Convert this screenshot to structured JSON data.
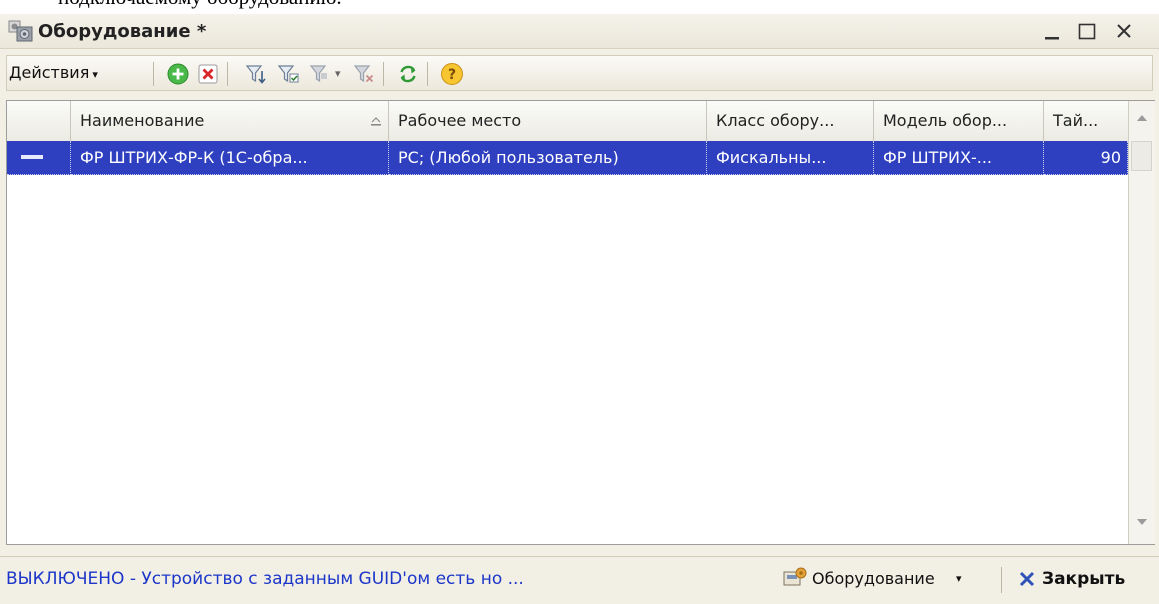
{
  "background_text": "подключаемому оборудованию.",
  "window": {
    "title": "Оборудование *",
    "controls": {
      "minimize": "_",
      "maximize": "□",
      "close": "×"
    }
  },
  "toolbar": {
    "actions_label": "Действия",
    "actions_caret": "▾",
    "icons": [
      "add-icon",
      "delete-icon",
      "filter-icon",
      "filter-by-value-icon",
      "filter-menu-icon",
      "clear-filter-icon",
      "refresh-icon",
      "help-icon"
    ]
  },
  "table": {
    "columns": [
      "Наименование",
      "Рабочее место",
      "Класс обору...",
      "Модель обор...",
      "Тай..."
    ],
    "rows": [
      {
        "name": "ФР ШТРИХ-ФР-К (1С-обра...",
        "workplace": "РС; (Любой пользователь)",
        "class": "Фискальны...",
        "model": "ФР ШТРИХ-...",
        "timeout": "90"
      }
    ]
  },
  "status": {
    "message": "ВЫКЛЮЧЕНО - Устройство с заданным GUID'ом есть но ...",
    "equipment_button": "Оборудование",
    "equipment_caret": "▾",
    "close_button": "Закрыть"
  },
  "colors": {
    "selection": "#2e3fbf",
    "status_text": "#1c36c9",
    "window_bg": "#f2efe4"
  }
}
